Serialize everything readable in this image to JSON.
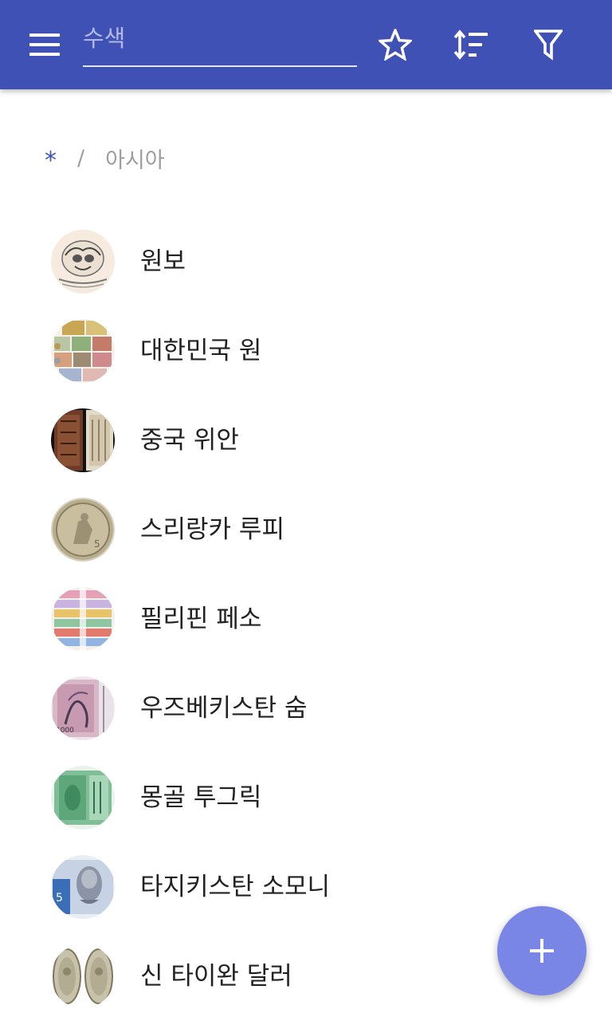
{
  "toolbar": {
    "search_placeholder": "수색",
    "search_value": "",
    "colors": {
      "app_bar": "#3f51b5",
      "accent": "#7986e6"
    }
  },
  "breadcrumb": {
    "root": "*",
    "separator": "/",
    "current": "아시아"
  },
  "list": {
    "items": [
      {
        "label": "원보",
        "icon": "ingot-thumbnail"
      },
      {
        "label": "대한민국 원",
        "icon": "korean-banknotes-thumbnail"
      },
      {
        "label": "중국 위안",
        "icon": "chinese-notes-thumbnail"
      },
      {
        "label": "스리랑카 루피",
        "icon": "coin-thumbnail"
      },
      {
        "label": "필리핀 페소",
        "icon": "philippine-banknotes-thumbnail"
      },
      {
        "label": "우즈베키스탄 숨",
        "icon": "uzbek-banknote-thumbnail"
      },
      {
        "label": "몽골 투그릭",
        "icon": "mongolian-banknote-thumbnail"
      },
      {
        "label": "타지키스탄 소모니",
        "icon": "tajik-banknote-thumbnail"
      },
      {
        "label": "신 타이완 달러",
        "icon": "taiwan-coins-thumbnail"
      }
    ]
  },
  "fab": {
    "icon": "plus-icon"
  }
}
